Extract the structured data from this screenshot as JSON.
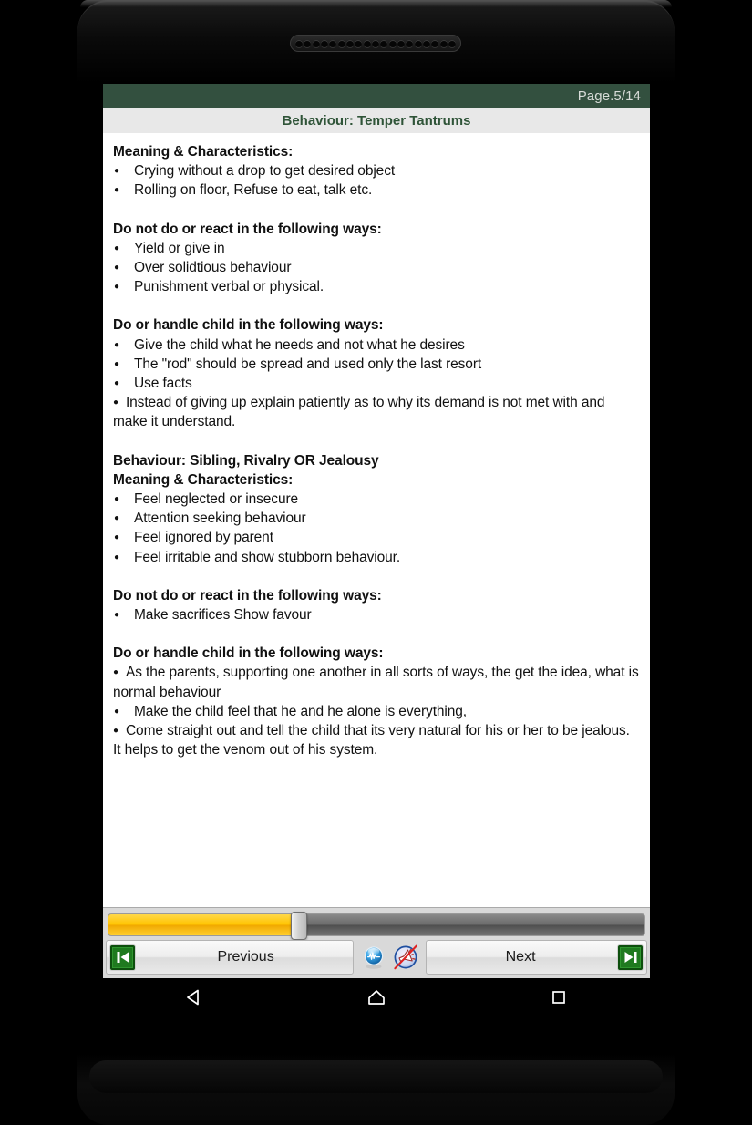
{
  "device": {
    "speaker_hole_count": 19
  },
  "reader": {
    "page_indicator": "Page.5/14",
    "title": "Behaviour: Temper Tantrums",
    "header_bg": "#33503f",
    "title_bg": "#e8e8e8",
    "title_color": "#2f5438",
    "progress_percent": 35.5,
    "progress_fill_color": "#FFC400",
    "progress_track_color": "#6b6b6b"
  },
  "content": {
    "blocks": [
      {
        "heading": "Meaning & Characteristics:",
        "items": [
          "Crying without a drop to get desired object",
          "Rolling on floor, Refuse to eat, talk etc."
        ]
      },
      {
        "heading": "Do not do or react in the following ways:",
        "items": [
          "Yield or give in",
          "Over solidtious behaviour",
          "Punishment verbal or physical."
        ]
      },
      {
        "heading": "Do or handle child in the following ways:",
        "items": [
          "Give the child what he needs and not what he desires",
          "The \"rod\" should be spread and used only the last resort",
          "Use facts",
          "Instead of giving up explain patiently as to why its demand is not met with and make it understand."
        ]
      },
      {
        "heading": "Behaviour: Sibling, Rivalry OR Jealousy",
        "heading2": "Meaning & Characteristics:",
        "items": [
          "Feel neglected or insecure",
          "Attention seeking behaviour",
          "Feel ignored by parent",
          "Feel irritable and show stubborn behaviour."
        ]
      },
      {
        "heading": "Do not do or react in the following ways:",
        "items": [
          "Make sacrifices Show favour"
        ]
      },
      {
        "heading": "Do or handle child in the following ways:",
        "items": [
          "As the parents, supporting one another in all sorts of ways, the get the idea, what is normal behaviour",
          "Make the child feel that he and he alone is everything,",
          "Come straight out and tell the child that its very natural for his or her to be jealous. It helps to get the venom out of his system."
        ]
      }
    ]
  },
  "controls": {
    "previous_label": "Previous",
    "next_label": "Next",
    "first_page_icon": "skip-to-first-icon",
    "last_page_icon": "skip-to-last-icon",
    "sound_icon": "sound-waveform-icon",
    "mute_icon": "mute-megaphone-icon"
  },
  "android_nav": {
    "back": "back-triangle-icon",
    "home": "home-icon",
    "recents": "recents-square-icon"
  }
}
